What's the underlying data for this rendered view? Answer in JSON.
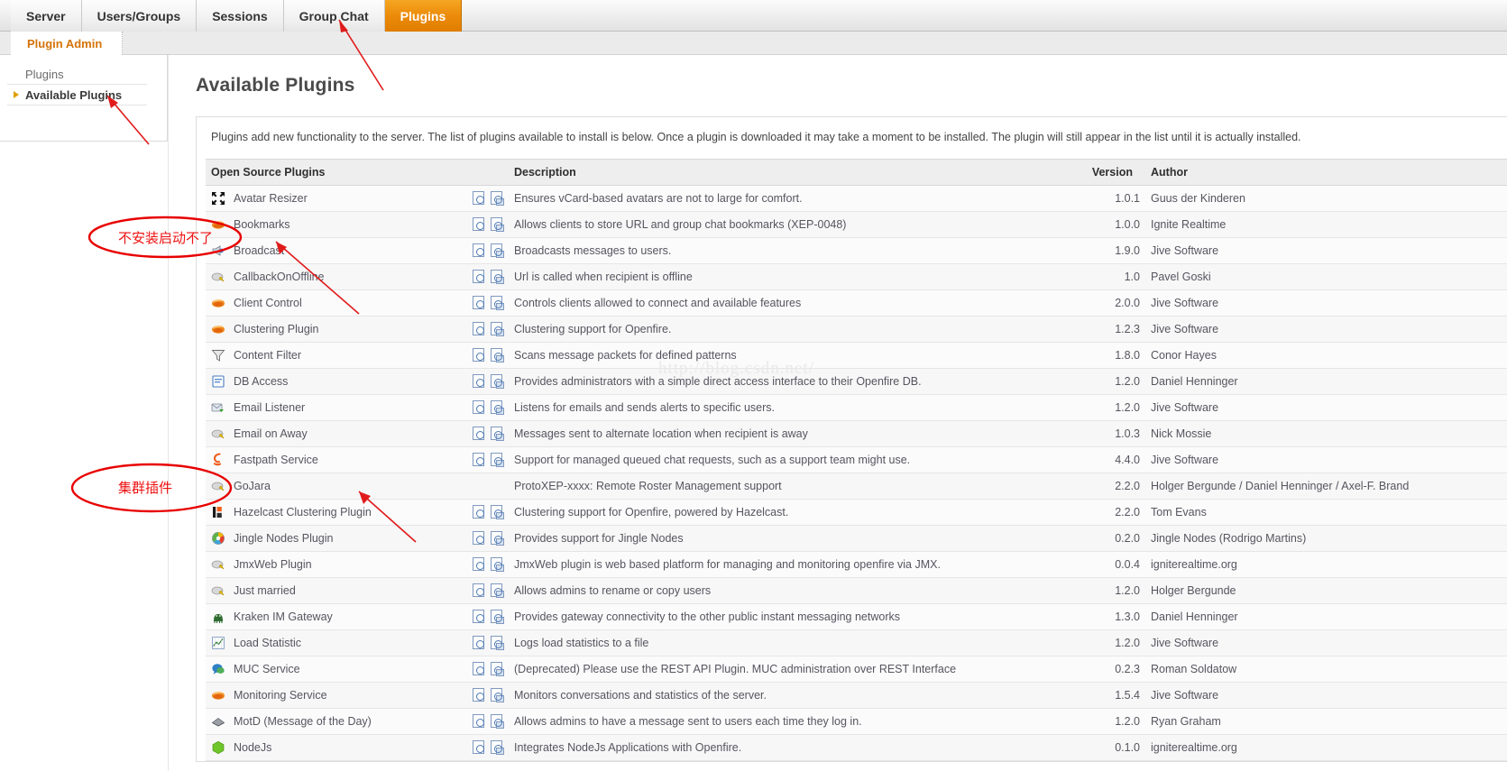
{
  "topnav": {
    "tabs": [
      {
        "id": "server",
        "label": "Server",
        "active": false
      },
      {
        "id": "users-groups",
        "label": "Users/Groups",
        "active": false
      },
      {
        "id": "sessions",
        "label": "Sessions",
        "active": false
      },
      {
        "id": "group-chat",
        "label": "Group Chat",
        "active": false
      },
      {
        "id": "plugins",
        "label": "Plugins",
        "active": true
      }
    ]
  },
  "subnav": {
    "label": "Plugin Admin"
  },
  "sidebar": {
    "items": [
      {
        "label": "Plugins",
        "selected": false
      },
      {
        "label": "Available Plugins",
        "selected": true
      }
    ]
  },
  "main": {
    "title": "Available Plugins",
    "intro": "Plugins add new functionality to the server. The list of plugins available to install is below. Once a plugin is downloaded it may take a moment to be installed. The plugin will still appear in the list until it is actually installed."
  },
  "table": {
    "headers": {
      "name": "Open Source Plugins",
      "icons": "",
      "description": "Description",
      "version": "Version",
      "author": "Author"
    },
    "rows": [
      {
        "name": "Avatar Resizer",
        "icon": "avatar-resizer-icon",
        "has_docs": true,
        "description": "Ensures vCard-based avatars are not to large for comfort.",
        "version": "1.0.1",
        "author": "Guus der Kinderen"
      },
      {
        "name": "Bookmarks",
        "icon": "bookmarks-icon",
        "has_docs": true,
        "description": "Allows clients to store URL and group chat bookmarks (XEP-0048)",
        "version": "1.0.0",
        "author": "Ignite Realtime"
      },
      {
        "name": "Broadcast",
        "icon": "broadcast-icon",
        "has_docs": true,
        "description": "Broadcasts messages to users.",
        "version": "1.9.0",
        "author": "Jive Software"
      },
      {
        "name": "CallbackOnOffline",
        "icon": "callback-icon",
        "has_docs": true,
        "description": "Url is called when recipient is offline",
        "version": "1.0",
        "author": "Pavel Goski"
      },
      {
        "name": "Client Control",
        "icon": "client-control-icon",
        "has_docs": true,
        "description": "Controls clients allowed to connect and available features",
        "version": "2.0.0",
        "author": "Jive Software"
      },
      {
        "name": "Clustering Plugin",
        "icon": "clustering-icon",
        "has_docs": true,
        "description": "Clustering support for Openfire.",
        "version": "1.2.3",
        "author": "Jive Software"
      },
      {
        "name": "Content Filter",
        "icon": "content-filter-icon",
        "has_docs": true,
        "description": "Scans message packets for defined patterns",
        "version": "1.8.0",
        "author": "Conor Hayes"
      },
      {
        "name": "DB Access",
        "icon": "db-access-icon",
        "has_docs": true,
        "description": "Provides administrators with a simple direct access interface to their Openfire DB.",
        "version": "1.2.0",
        "author": "Daniel Henninger"
      },
      {
        "name": "Email Listener",
        "icon": "email-listener-icon",
        "has_docs": true,
        "description": "Listens for emails and sends alerts to specific users.",
        "version": "1.2.0",
        "author": "Jive Software"
      },
      {
        "name": "Email on Away",
        "icon": "email-away-icon",
        "has_docs": true,
        "description": "Messages sent to alternate location when recipient is away",
        "version": "1.0.3",
        "author": "Nick Mossie"
      },
      {
        "name": "Fastpath Service",
        "icon": "fastpath-icon",
        "has_docs": true,
        "description": "Support for managed queued chat requests, such as a support team might use.",
        "version": "4.4.0",
        "author": "Jive Software"
      },
      {
        "name": "GoJara",
        "icon": "gojara-icon",
        "has_docs": false,
        "description": "ProtoXEP-xxxx: Remote Roster Management support",
        "version": "2.2.0",
        "author": "Holger Bergunde / Daniel Henninger / Axel-F. Brand"
      },
      {
        "name": "Hazelcast Clustering Plugin",
        "icon": "hazelcast-icon",
        "has_docs": true,
        "description": "Clustering support for Openfire, powered by Hazelcast.",
        "version": "2.2.0",
        "author": "Tom Evans"
      },
      {
        "name": "Jingle Nodes Plugin",
        "icon": "jingle-nodes-icon",
        "has_docs": true,
        "description": "Provides support for Jingle Nodes",
        "version": "0.2.0",
        "author": "Jingle Nodes (Rodrigo Martins)"
      },
      {
        "name": "JmxWeb Plugin",
        "icon": "jmxweb-icon",
        "has_docs": true,
        "description": "JmxWeb plugin is web based platform for managing and monitoring openfire via JMX.",
        "version": "0.0.4",
        "author": "igniterealtime.org"
      },
      {
        "name": "Just married",
        "icon": "just-married-icon",
        "has_docs": true,
        "description": "Allows admins to rename or copy users",
        "version": "1.2.0",
        "author": "Holger Bergunde"
      },
      {
        "name": "Kraken IM Gateway",
        "icon": "kraken-icon",
        "has_docs": true,
        "description": "Provides gateway connectivity to the other public instant messaging networks",
        "version": "1.3.0",
        "author": "Daniel Henninger"
      },
      {
        "name": "Load Statistic",
        "icon": "load-statistic-icon",
        "has_docs": true,
        "description": "Logs load statistics to a file",
        "version": "1.2.0",
        "author": "Jive Software"
      },
      {
        "name": "MUC Service",
        "icon": "muc-service-icon",
        "has_docs": true,
        "description": "(Deprecated) Please use the REST API Plugin. MUC administration over REST Interface",
        "version": "0.2.3",
        "author": "Roman Soldatow"
      },
      {
        "name": "Monitoring Service",
        "icon": "monitoring-icon",
        "has_docs": true,
        "description": "Monitors conversations and statistics of the server.",
        "version": "1.5.4",
        "author": "Jive Software"
      },
      {
        "name": "MotD (Message of the Day)",
        "icon": "motd-icon",
        "has_docs": true,
        "description": "Allows admins to have a message sent to users each time they log in.",
        "version": "1.2.0",
        "author": "Ryan Graham"
      },
      {
        "name": "NodeJs",
        "icon": "nodejs-icon",
        "has_docs": true,
        "description": "Integrates NodeJs Applications with Openfire.",
        "version": "0.1.0",
        "author": "igniterealtime.org"
      }
    ]
  },
  "annotations": {
    "note_broadcast": "不安装启动不了",
    "note_cluster": "集群插件",
    "color": "#ee1111"
  },
  "watermark": {
    "text": "http://blog.csdn.net/"
  }
}
